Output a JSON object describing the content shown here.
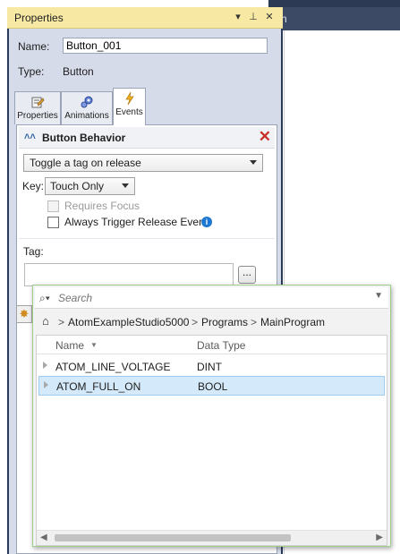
{
  "background": {
    "tab_fragment": "n"
  },
  "panel": {
    "title": "Properties",
    "title_buttons": {
      "dropdown": "▾",
      "pin": "⊥",
      "close": "✕"
    },
    "name_label": "Name:",
    "name_value": "Button_001",
    "type_label": "Type:",
    "type_value": "Button",
    "tabs": [
      {
        "label": "Properties",
        "icon": "properties-icon"
      },
      {
        "label": "Animations",
        "icon": "animations-icon"
      },
      {
        "label": "Events",
        "icon": "events-lightning-icon",
        "active": true
      }
    ]
  },
  "behavior": {
    "section_title": "Button Behavior",
    "selected_action": "Toggle a tag on release",
    "key_label": "Key:",
    "key_value": "Touch Only",
    "requires_focus": "Requires Focus",
    "always_trigger": "Always Trigger Release Event",
    "tag_label": "Tag:",
    "tag_value": "",
    "browse_label": "..."
  },
  "tag_browser": {
    "search_placeholder": "Search",
    "breadcrumb": [
      "AtomExampleStudio5000",
      "Programs",
      "MainProgram"
    ],
    "columns": {
      "name": "Name",
      "type": "Data Type"
    },
    "rows": [
      {
        "name": "ATOM_LINE_VOLTAGE",
        "type": "DINT",
        "selected": false
      },
      {
        "name": "ATOM_FULL_ON",
        "type": "BOOL",
        "selected": true
      }
    ]
  },
  "colors": {
    "title_bar": "#f7e9a4",
    "panel_frame": "#2b3a5a",
    "panel_body": "#d6dbe9",
    "selection": "#d4e9f9",
    "close_red": "#c8302a",
    "info_blue": "#1e78d2"
  }
}
